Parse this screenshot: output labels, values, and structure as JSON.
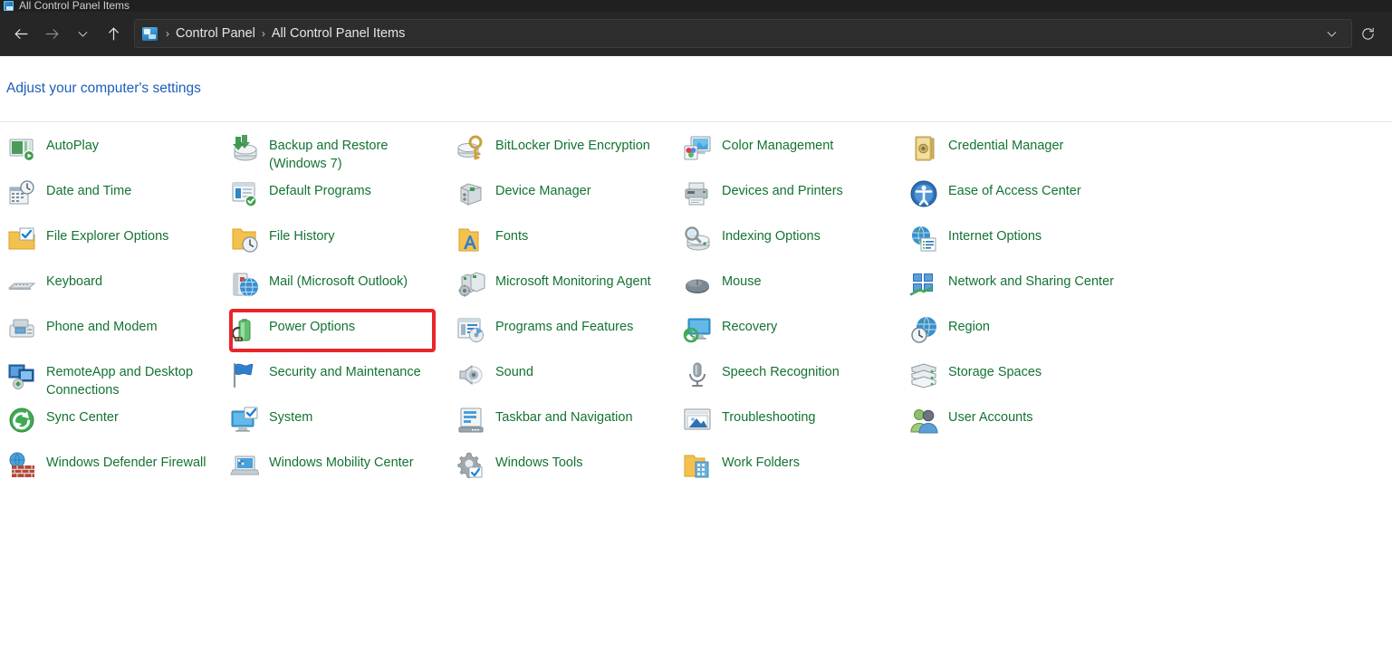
{
  "window": {
    "tab_title": "All Control Panel Items",
    "tab_icon": "control-panel-icon"
  },
  "toolbar": {
    "back_icon": "back-arrow-icon",
    "forward_icon": "forward-arrow-icon",
    "recent_icon": "chevron-down-icon",
    "up_icon": "up-arrow-icon",
    "address_dropdown_icon": "chevron-down-icon",
    "refresh_icon": "refresh-icon"
  },
  "breadcrumb": {
    "icon": "control-panel-icon",
    "separator": "›",
    "items": [
      "Control Panel",
      "All Control Panel Items"
    ]
  },
  "heading": {
    "text": "Adjust your computer's settings"
  },
  "colors": {
    "link_green": "#137333",
    "heading_blue": "#1c5fb8",
    "annotation_red": "#e8262a",
    "titlebar_bg": "#202020",
    "navbar_bg": "#262626",
    "content_bg": "#ffffff"
  },
  "annotation": {
    "target": "Power Options",
    "shape": "rectangle",
    "color": "#e8262a"
  },
  "items": [
    {
      "label": "AutoPlay",
      "icon": "autoplay-icon",
      "col": 0,
      "row": 0
    },
    {
      "label": "Date and Time",
      "icon": "date-and-time-icon",
      "col": 0,
      "row": 1
    },
    {
      "label": "File Explorer Options",
      "icon": "file-explorer-options-icon",
      "col": 0,
      "row": 2
    },
    {
      "label": "Keyboard",
      "icon": "keyboard-icon",
      "col": 0,
      "row": 3
    },
    {
      "label": "Phone and Modem",
      "icon": "phone-and-modem-icon",
      "col": 0,
      "row": 4
    },
    {
      "label": "RemoteApp and Desktop Connections",
      "icon": "remoteapp-icon",
      "col": 0,
      "row": 5
    },
    {
      "label": "Sync Center",
      "icon": "sync-center-icon",
      "col": 0,
      "row": 6
    },
    {
      "label": "Windows Defender Firewall",
      "icon": "firewall-icon",
      "col": 0,
      "row": 7
    },
    {
      "label": "Backup and Restore (Windows 7)",
      "icon": "backup-restore-icon",
      "col": 1,
      "row": 0
    },
    {
      "label": "Default Programs",
      "icon": "default-programs-icon",
      "col": 1,
      "row": 1
    },
    {
      "label": "File History",
      "icon": "file-history-icon",
      "col": 1,
      "row": 2
    },
    {
      "label": "Mail (Microsoft Outlook)",
      "icon": "mail-icon",
      "col": 1,
      "row": 3
    },
    {
      "label": "Power Options",
      "icon": "power-options-icon",
      "col": 1,
      "row": 4
    },
    {
      "label": "Security and Maintenance",
      "icon": "security-maintenance-icon",
      "col": 1,
      "row": 5
    },
    {
      "label": "System",
      "icon": "system-icon",
      "col": 1,
      "row": 6
    },
    {
      "label": "Windows Mobility Center",
      "icon": "mobility-center-icon",
      "col": 1,
      "row": 7
    },
    {
      "label": "BitLocker Drive Encryption",
      "icon": "bitlocker-icon",
      "col": 2,
      "row": 0
    },
    {
      "label": "Device Manager",
      "icon": "device-manager-icon",
      "col": 2,
      "row": 1
    },
    {
      "label": "Fonts",
      "icon": "fonts-icon",
      "col": 2,
      "row": 2
    },
    {
      "label": "Microsoft Monitoring Agent",
      "icon": "monitoring-agent-icon",
      "col": 2,
      "row": 3
    },
    {
      "label": "Programs and Features",
      "icon": "programs-features-icon",
      "col": 2,
      "row": 4
    },
    {
      "label": "Sound",
      "icon": "sound-icon",
      "col": 2,
      "row": 5
    },
    {
      "label": "Taskbar and Navigation",
      "icon": "taskbar-navigation-icon",
      "col": 2,
      "row": 6
    },
    {
      "label": "Windows Tools",
      "icon": "windows-tools-icon",
      "col": 2,
      "row": 7
    },
    {
      "label": "Color Management",
      "icon": "color-management-icon",
      "col": 3,
      "row": 0
    },
    {
      "label": "Devices and Printers",
      "icon": "devices-printers-icon",
      "col": 3,
      "row": 1
    },
    {
      "label": "Indexing Options",
      "icon": "indexing-options-icon",
      "col": 3,
      "row": 2
    },
    {
      "label": "Mouse",
      "icon": "mouse-icon",
      "col": 3,
      "row": 3
    },
    {
      "label": "Recovery",
      "icon": "recovery-icon",
      "col": 3,
      "row": 4
    },
    {
      "label": "Speech Recognition",
      "icon": "speech-recognition-icon",
      "col": 3,
      "row": 5
    },
    {
      "label": "Troubleshooting",
      "icon": "troubleshooting-icon",
      "col": 3,
      "row": 6
    },
    {
      "label": "Work Folders",
      "icon": "work-folders-icon",
      "col": 3,
      "row": 7
    },
    {
      "label": "Credential Manager",
      "icon": "credential-manager-icon",
      "col": 4,
      "row": 0
    },
    {
      "label": "Ease of Access Center",
      "icon": "ease-of-access-icon",
      "col": 4,
      "row": 1
    },
    {
      "label": "Internet Options",
      "icon": "internet-options-icon",
      "col": 4,
      "row": 2
    },
    {
      "label": "Network and Sharing Center",
      "icon": "network-sharing-icon",
      "col": 4,
      "row": 3
    },
    {
      "label": "Region",
      "icon": "region-icon",
      "col": 4,
      "row": 4
    },
    {
      "label": "Storage Spaces",
      "icon": "storage-spaces-icon",
      "col": 4,
      "row": 5
    },
    {
      "label": "User Accounts",
      "icon": "user-accounts-icon",
      "col": 4,
      "row": 6
    }
  ]
}
